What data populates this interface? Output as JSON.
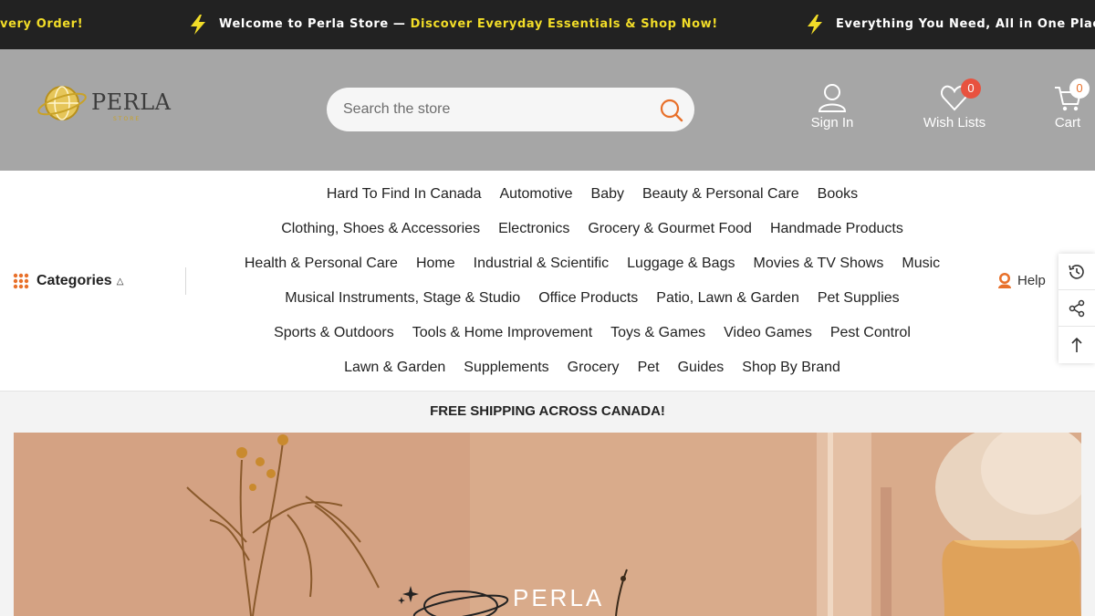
{
  "announcement": {
    "item1_tail": "very Order!",
    "item2_lead": "Welcome to Perla Store — ",
    "item2_highlight": "Discover Everyday Essentials & Shop Now!",
    "item3": "Everything You Need, All in One Place"
  },
  "header": {
    "logo_text": "PERLA",
    "logo_subtext": "STORE",
    "search_placeholder": "Search the store",
    "signin_label": "Sign In",
    "wishlist_label": "Wish Lists",
    "wishlist_count": "0",
    "cart_label": "Cart",
    "cart_count": "0"
  },
  "nav": {
    "categories_label": "Categories",
    "help_label": "Help",
    "rows": [
      [
        "Hard To Find In Canada",
        "Automotive",
        "Baby",
        "Beauty & Personal Care",
        "Books"
      ],
      [
        "Clothing, Shoes & Accessories",
        "Electronics",
        "Grocery & Gourmet Food",
        "Handmade Products"
      ],
      [
        "Health & Personal Care",
        "Home",
        "Industrial & Scientific",
        "Luggage & Bags",
        "Movies & TV Shows",
        "Music"
      ],
      [
        "Musical Instruments, Stage & Studio",
        "Office Products",
        "Patio, Lawn & Garden",
        "Pet Supplies"
      ],
      [
        "Sports & Outdoors",
        "Tools & Home Improvement",
        "Toys & Games",
        "Video Games",
        "Pest Control"
      ],
      [
        "Lawn & Garden",
        "Supplements",
        "Grocery",
        "Pet",
        "Guides",
        "Shop By Brand"
      ]
    ]
  },
  "shipping_banner": "FREE SHIPPING ACROSS CANADA!",
  "hero": {
    "brand": "PERLA"
  },
  "colors": {
    "announce_bg": "#222222",
    "announce_highlight": "#f2dd28",
    "header_bg": "#a6a6a6",
    "accent_orange": "#e8702a",
    "badge_red": "#e8523f",
    "hero_bg": "#d7a888"
  },
  "icons": {
    "bolt": "lightning-bolt-icon",
    "search": "search-icon",
    "signin": "user-icon",
    "wishlist": "heart-icon",
    "cart": "cart-icon",
    "categories": "grid-icon",
    "help": "support-agent-icon",
    "recent": "history-icon",
    "share": "share-icon",
    "top": "arrow-up-icon"
  }
}
